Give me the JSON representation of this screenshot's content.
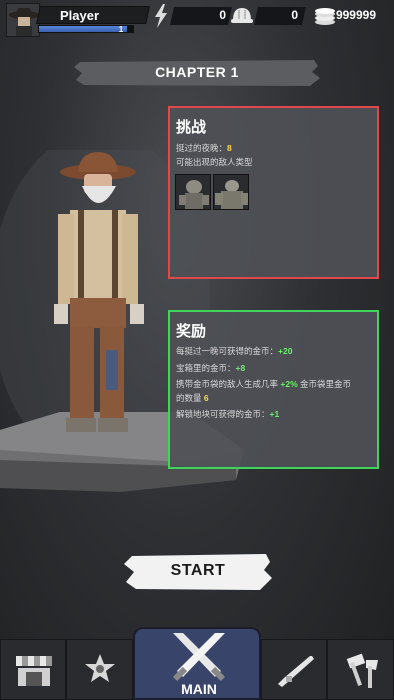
{
  "player": {
    "name": "Player",
    "level": "1",
    "xp_fraction": 0.94
  },
  "resources": {
    "energy": "0",
    "helmet": "0",
    "coins": "999999"
  },
  "chapter": {
    "title": "CHAPTER 1"
  },
  "challenge": {
    "title": "挑战",
    "nights_label": "挺过的夜晚：",
    "nights_value": "8",
    "enemies_label": "可能出现的敌人类型"
  },
  "reward": {
    "title": "奖励",
    "line1_label": "每挺过一晚可获得的金币：",
    "line1_value": "+20",
    "line2_label": "宝箱里的金币：",
    "line2_value": "+8",
    "line3_label_a": "携带金币袋的敌人生成几率",
    "line3_value_a": "+2%",
    "line3_label_b": "金币袋里金币",
    "line3_label_c": "的数量",
    "line3_value_b": "6",
    "line4_label": "解锁地块可获得的金币：",
    "line4_value": "+1"
  },
  "start_label": "START",
  "nav": {
    "main_label": "MAIN"
  },
  "colors": {
    "challenge_border": "#e0484a",
    "reward_border": "#3fd45a",
    "main_tab": "#39446b"
  }
}
